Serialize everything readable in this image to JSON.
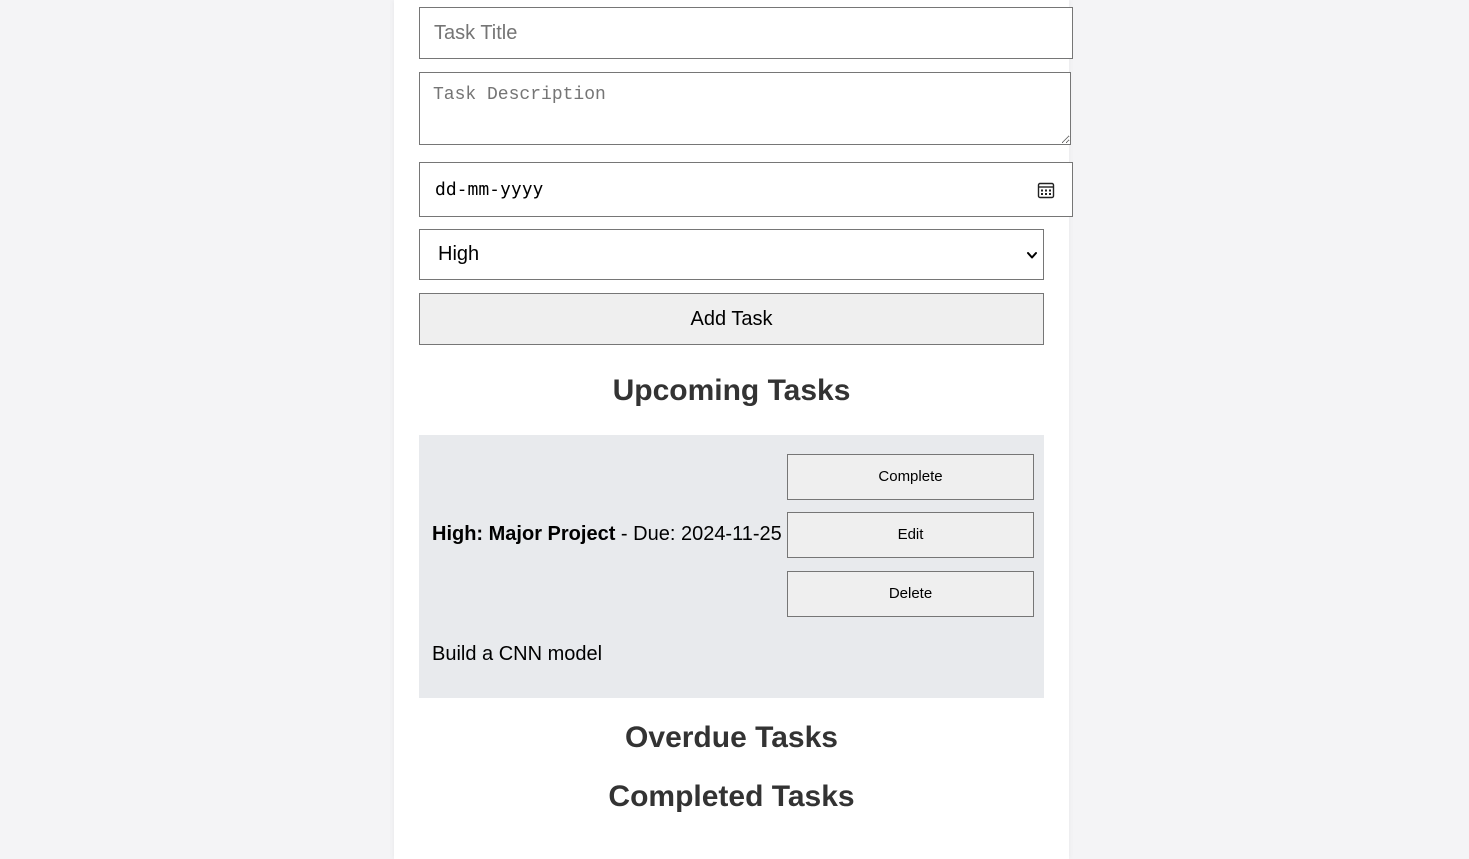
{
  "form": {
    "title_placeholder": "Task Title",
    "description_placeholder": "Task Description",
    "date_placeholder": "dd-mm-yyyy",
    "priority_selected": "High",
    "add_button_label": "Add Task"
  },
  "sections": {
    "upcoming_heading": "Upcoming Tasks",
    "overdue_heading": "Overdue Tasks",
    "completed_heading": "Completed Tasks"
  },
  "upcoming_tasks": [
    {
      "heading": "High: Major Project",
      "separator": " - ",
      "due": "Due: 2024-11-25",
      "description": "Build a CNN model",
      "complete_label": "Complete",
      "edit_label": "Edit",
      "delete_label": "Delete"
    }
  ],
  "icons": {
    "calendar": "calendar-icon",
    "dropdown": "chevron-down-icon"
  },
  "colors": {
    "page_background": "#f4f4f6",
    "container_background": "#ffffff",
    "task_card_background": "#e8eaed",
    "button_background": "#efefef",
    "heading_color": "#333333"
  }
}
